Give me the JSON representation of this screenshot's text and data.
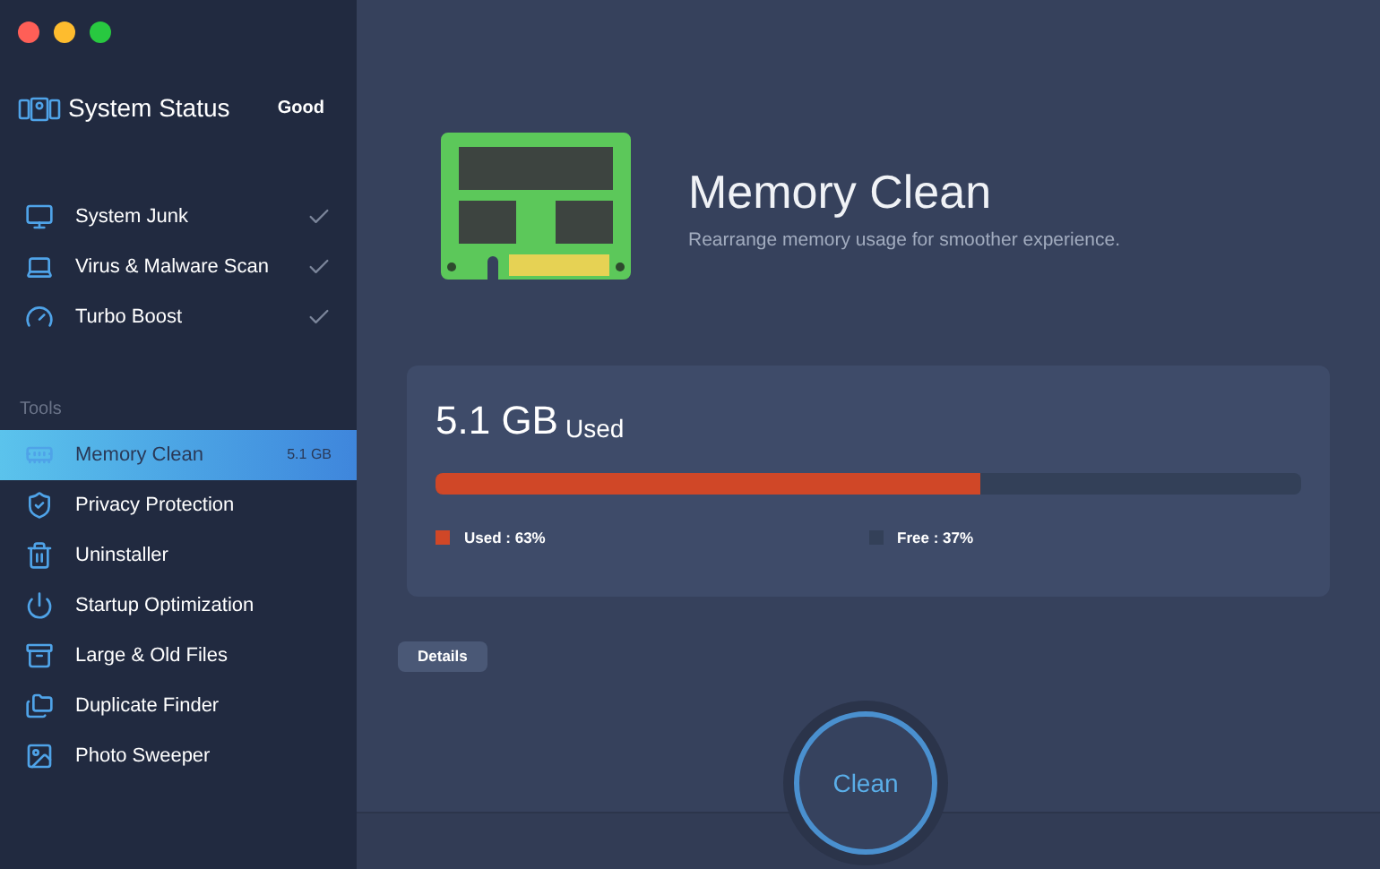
{
  "sidebar": {
    "status": {
      "title": "System Status",
      "value": "Good"
    },
    "scans": [
      {
        "label": "System Junk",
        "checked": true
      },
      {
        "label": "Virus & Malware Scan",
        "checked": true
      },
      {
        "label": "Turbo Boost",
        "checked": true
      }
    ],
    "tools_heading": "Tools",
    "tools": [
      {
        "label": "Memory Clean",
        "selected": true,
        "badge": "5.1 GB"
      },
      {
        "label": "Privacy Protection",
        "selected": false
      },
      {
        "label": "Uninstaller",
        "selected": false
      },
      {
        "label": "Startup Optimization",
        "selected": false
      },
      {
        "label": "Large & Old Files",
        "selected": false
      },
      {
        "label": "Duplicate Finder",
        "selected": false
      },
      {
        "label": "Photo Sweeper",
        "selected": false
      }
    ]
  },
  "header": {
    "title": "Memory Clean",
    "subtitle": "Rearrange memory usage for smoother experience."
  },
  "usage": {
    "amount": "5.1 GB",
    "unit": "Used",
    "level": 0.63,
    "legend": [
      {
        "label": "Used : 63%",
        "color": "#d04727"
      },
      {
        "label": "Free : 37%",
        "color": "#334058"
      }
    ]
  },
  "details_button": "Details",
  "clean_button": "Clean"
}
